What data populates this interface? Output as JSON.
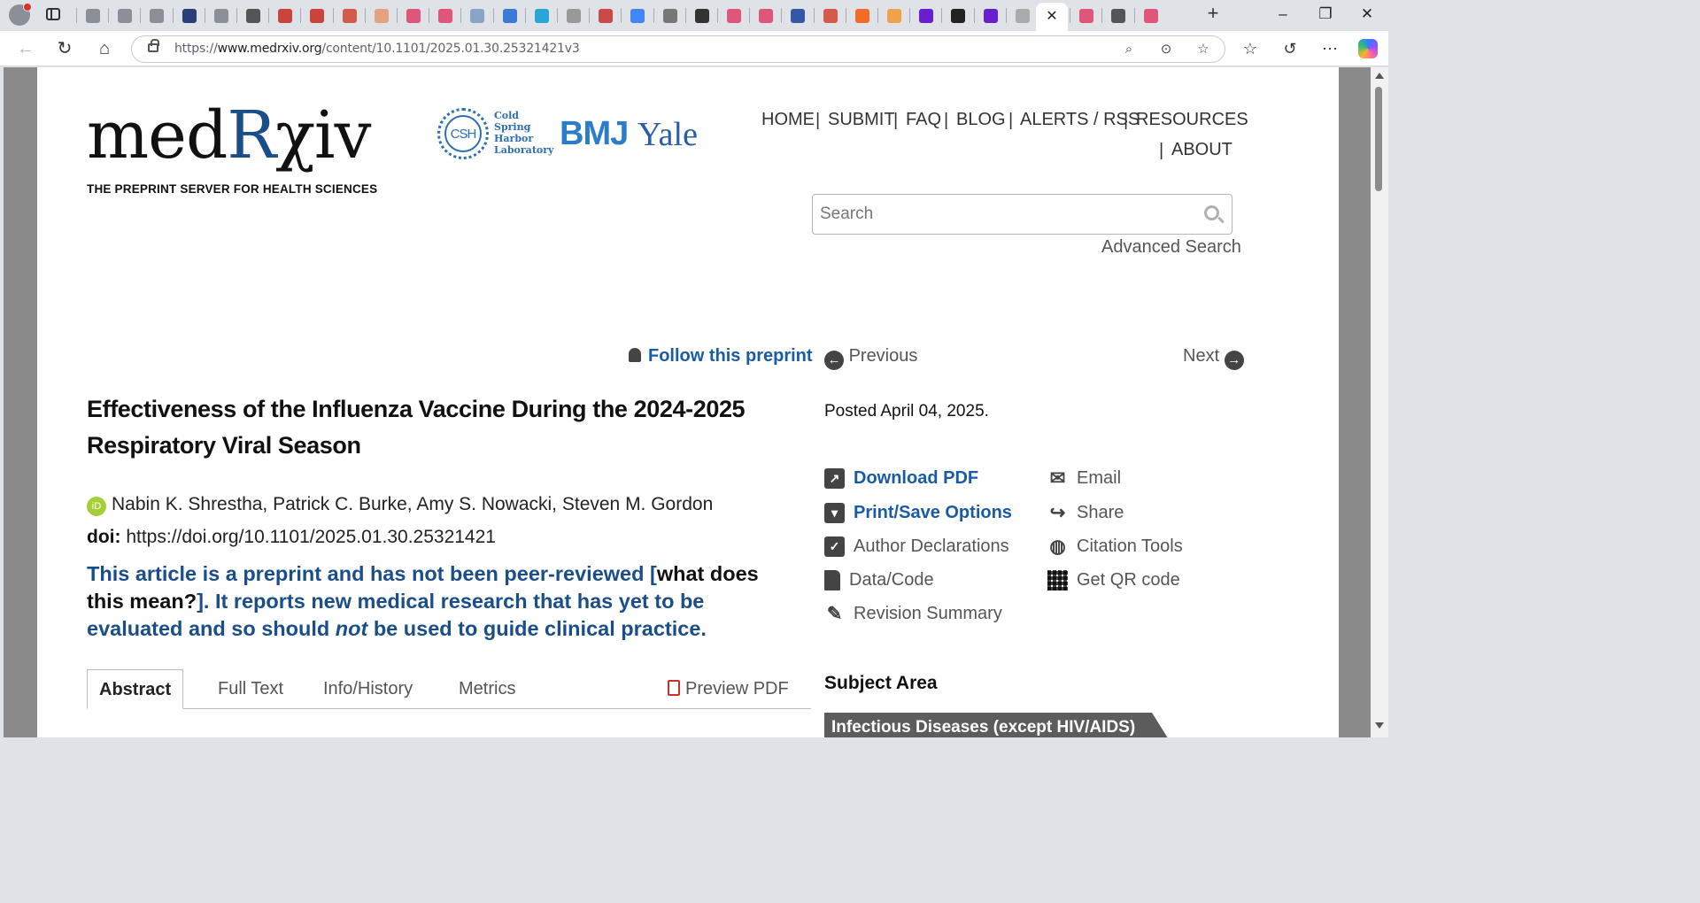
{
  "browser": {
    "url_prefix": "https://",
    "url_host": "www.medrxiv.org",
    "url_path": "/content/10.1101/2025.01.30.25321421v3",
    "tab_favicon_colors": [
      "#8a8f98",
      "#8a8f98",
      "#8a8f98",
      "#2c3e78",
      "#8a8f98",
      "#555",
      "#c8443c",
      "#c8443c",
      "#d45a4a",
      "#e4a37f",
      "#e0567a",
      "#e0567a",
      "#8aa4c8",
      "#3d7ad6",
      "#2aa5d8",
      "#999",
      "#c84a4a",
      "#4285f4",
      "#777",
      "#333",
      "#e0567a",
      "#e0567a",
      "#3557a6",
      "#d45a4a",
      "#ef6c2a",
      "#f0a24a",
      "#6a1fcf",
      "#222",
      "#6a1fcf",
      "#aaa",
      "#777",
      "#e0567a",
      "#555",
      "#e0567a"
    ]
  },
  "header": {
    "logo_left": "med",
    "logo_r": "R",
    "logo_right": "χiv",
    "tagline": "THE PREPRINT SERVER FOR HEALTH SCIENCES",
    "partner_csh_mark": "CSH",
    "partner_csh_text": [
      "Cold",
      "Spring",
      "Harbor",
      "Laboratory"
    ],
    "partner_bmj": "BMJ",
    "partner_yale": "Yale"
  },
  "topnav": {
    "items": [
      "HOME",
      "SUBMIT",
      "FAQ",
      "BLOG",
      "ALERTS / RSS",
      "RESOURCES",
      "ABOUT"
    ],
    "separator": "|"
  },
  "search": {
    "placeholder": "Search",
    "advanced": "Advanced Search"
  },
  "article_nav": {
    "follow": "Follow this preprint",
    "previous": "Previous",
    "next": "Next"
  },
  "article": {
    "title": "Effectiveness of the Influenza Vaccine During the 2024-2025 Respiratory Viral Season",
    "orcid_mark": "iD",
    "authors": "Nabin K. Shrestha, Patrick C. Burke, Amy S. Nowacki, Steven M. Gordon",
    "doi_label": "doi:",
    "doi_value": "https://doi.org/10.1101/2025.01.30.25321421",
    "notice_part1": "This article is a preprint and has not been peer-reviewed [",
    "notice_link": "what does this mean?",
    "notice_part2": "]. It reports new medical research that has yet to be evaluated and so should ",
    "notice_em": "not",
    "notice_part3": " be used to guide clinical practice.",
    "posted": "Posted April 04, 2025."
  },
  "content_tabs": {
    "abstract": "Abstract",
    "full_text": "Full Text",
    "info_history": "Info/History",
    "metrics": "Metrics",
    "preview_pdf": "Preview PDF"
  },
  "actions": {
    "download_pdf": "Download PDF",
    "print_save": "Print/Save Options",
    "author_declarations": "Author Declarations",
    "data_code": "Data/Code",
    "revision_summary": "Revision Summary",
    "email": "Email",
    "share": "Share",
    "citation_tools": "Citation Tools",
    "qr_code": "Get QR code"
  },
  "sidebar": {
    "subject_area_title": "Subject Area",
    "subject_tag": "Infectious Diseases (except HIV/AIDS)"
  },
  "colors": {
    "link_blue": "#1a5ba6",
    "notice_blue": "#1a4e8a",
    "subject_tag_bg": "#5c5c5c",
    "orcid_green": "#a6ce39"
  }
}
